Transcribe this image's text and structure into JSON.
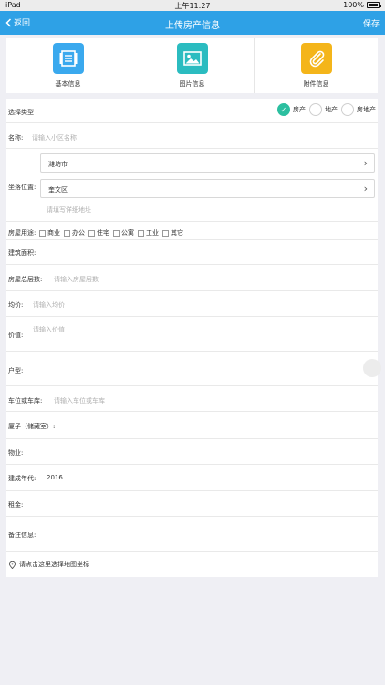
{
  "status_bar": {
    "carrier": "iPad",
    "time": "上午11:27",
    "battery": "100%"
  },
  "nav": {
    "back_label": "返回",
    "title": "上传房产信息",
    "save_label": "保存"
  },
  "tabs": [
    {
      "label": "基本信息",
      "icon": "document-icon",
      "color": "#3aa9ee"
    },
    {
      "label": "图片信息",
      "icon": "image-icon",
      "color": "#2bbcc0"
    },
    {
      "label": "附件信息",
      "icon": "paperclip-icon",
      "color": "#f4b51a"
    }
  ],
  "form": {
    "type": {
      "label": "选择类型",
      "options": [
        {
          "label": "房产",
          "checked": true
        },
        {
          "label": "地产",
          "checked": false
        },
        {
          "label": "房地产",
          "checked": false
        }
      ]
    },
    "name": {
      "label": "名称:",
      "placeholder": "请输入小区名称"
    },
    "location": {
      "label": "坐落位置:",
      "city": "潍坊市",
      "district": "奎文区",
      "address_placeholder": "请填写详细地址"
    },
    "usage": {
      "label": "房屋用途:",
      "options": [
        "商业",
        "办公",
        "住宅",
        "公寓",
        "工业",
        "其它"
      ]
    },
    "area": {
      "label": "建筑面积:"
    },
    "floors": {
      "label": "房屋总层数:",
      "placeholder": "请输入房屋层数"
    },
    "unit_price": {
      "label": "均价:",
      "placeholder": "请输入均价"
    },
    "value": {
      "label": "价值:",
      "placeholder": "请输入价值"
    },
    "layout": {
      "label": "户型:"
    },
    "parking": {
      "label": "车位或车库:",
      "placeholder": "请输入车位或车库"
    },
    "storage": {
      "label": "厦子（储藏室）:"
    },
    "property": {
      "label": "物业:"
    },
    "year": {
      "label": "建成年代:",
      "value": "2016"
    },
    "rent": {
      "label": "租金:"
    },
    "remarks": {
      "label": "备注信息:"
    },
    "map": {
      "label": "请点击这里选择地图坐标"
    }
  }
}
